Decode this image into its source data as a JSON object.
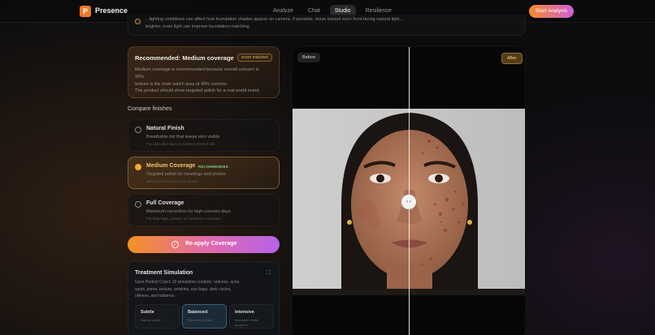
{
  "nav": {
    "logo_letter": "P",
    "brand": "Presence",
    "links": [
      "Analyze",
      "Chat",
      "Studio",
      "Resilience"
    ],
    "active": "Studio",
    "cta": "Start Analysis"
  },
  "tip": {
    "line1": "...lighting conditions can affect how foundation shades appear on camera. If possible, move toward even front-facing natural light...",
    "line2": "brighter, even light can improve foundation matching."
  },
  "recommendation": {
    "title": "Recommended: Medium coverage",
    "badge": "score matched",
    "lines": [
      "Medium coverage is recommended because overall concern is",
      "30%.",
      "texture is the main watch area at 45% concern.",
      "The product should show targeted polish for a real-world event."
    ]
  },
  "compare": {
    "title": "Compare finishes",
    "options": [
      {
        "name": "Natural Finish",
        "desc": "Breathable tint that keeps skin visible",
        "sub": "For calm-skin days or a breezy fresh finish",
        "selected": false,
        "badge": ""
      },
      {
        "name": "Medium Coverage",
        "desc": "Targeted polish for meetings and photos",
        "sub": "Best match for your scan scores",
        "selected": true,
        "badge": "RECOMMENDED"
      },
      {
        "name": "Full Coverage",
        "desc": "Maximum correction for high-concern days",
        "sub": "For flare days, photos, or maximum correction",
        "selected": false,
        "badge": ""
      }
    ]
  },
  "reapply": {
    "label": "Re-apply Coverage",
    "icon": "check-circle-icon"
  },
  "simulation": {
    "title": "Treatment Simulation",
    "icon": "expand-icon",
    "desc_lines": [
      "Uses Perfect Corp's 10 simulation controls: redness, acne,",
      "spots, pores, texture, wrinkles, eye bags, dark circles,",
      "oiliness, and radiance."
    ],
    "options": [
      {
        "name": "Subtle",
        "sub": "Natural polish",
        "selected": false
      },
      {
        "name": "Balanced",
        "sub": "Best daily default",
        "selected": true
      },
      {
        "name": "Intensive",
        "sub": "Strongest visible progress",
        "selected": false
      }
    ]
  },
  "viewer": {
    "before_label": "Before",
    "after_label": "After",
    "handle_glyph": "‹ ›",
    "slider_position": 0.5
  },
  "colors": {
    "accent_orange": "#f58a2a",
    "accent_purple": "#b563e8",
    "selected_gold": "#f0a93a",
    "recommended_green": "#7fd08a"
  }
}
